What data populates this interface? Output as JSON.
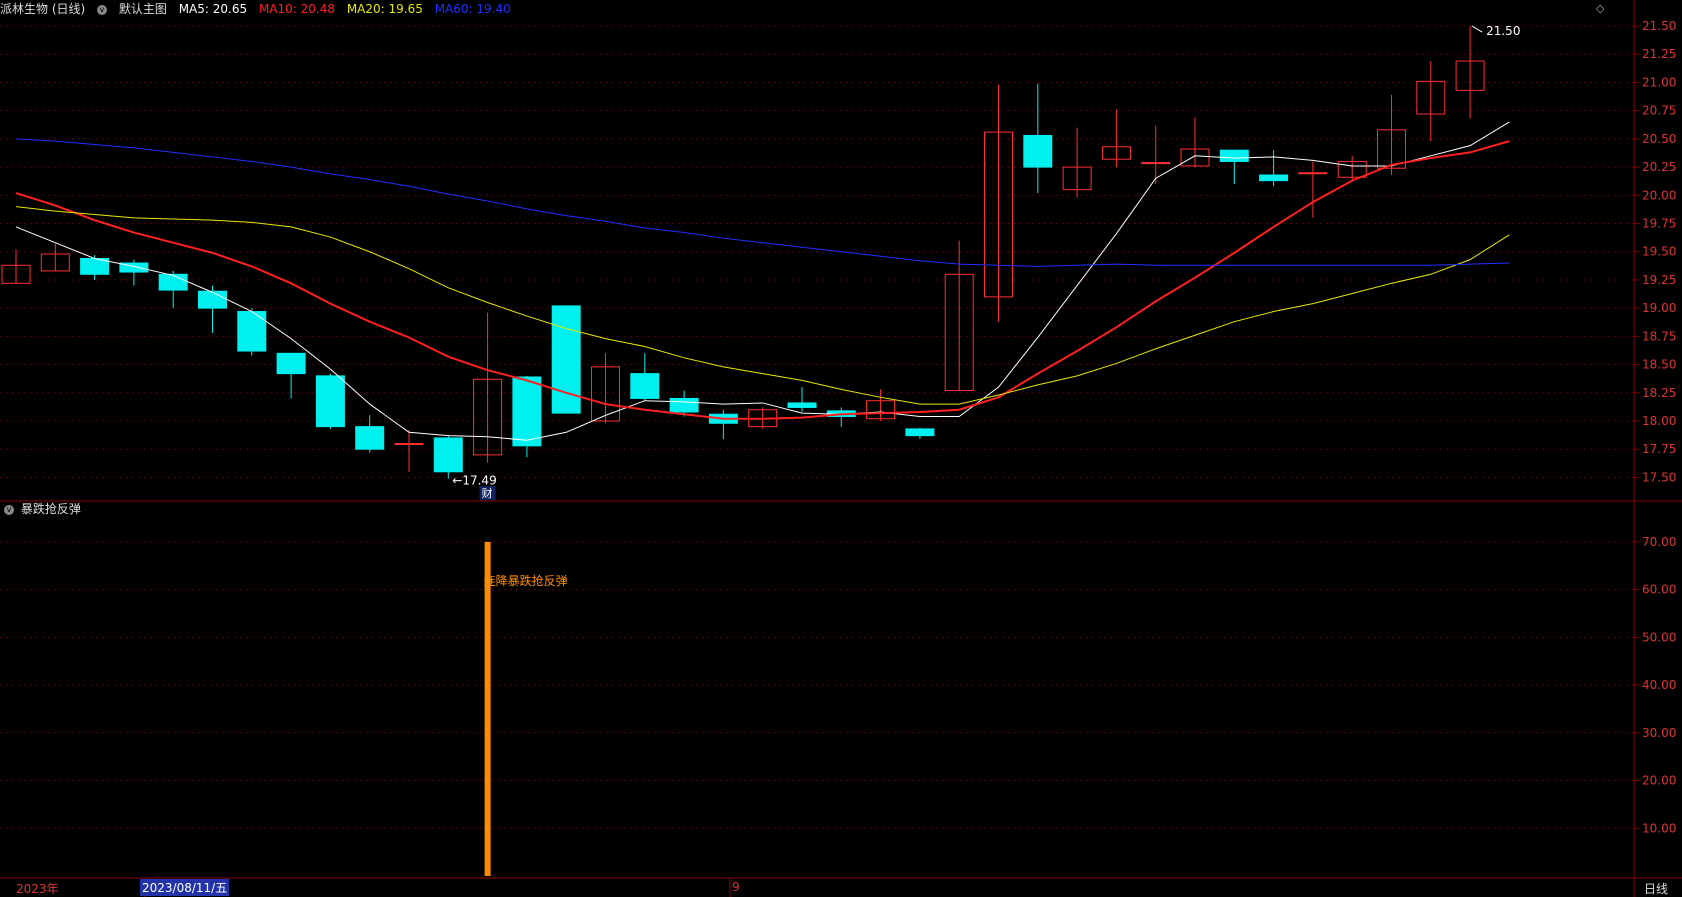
{
  "header": {
    "stock": "派林生物 (日线)",
    "layout": "默认主图",
    "ma5": "MA5: 20.65",
    "ma10": "MA10: 20.48",
    "ma20": "MA20: 19.65",
    "ma60": "MA60: 19.40",
    "colors": {
      "ma5": "#ffffff",
      "ma10": "#ff2020",
      "ma20": "#e8e800",
      "ma60": "#2030ff"
    }
  },
  "indicator_title": "暴跌抢反弹",
  "footer": {
    "year_label": "2023年",
    "cursor_date": "2023/08/11/五",
    "month_label": "9",
    "period_label": "日线"
  },
  "chart_data": [
    {
      "type": "candlestick",
      "title": "派林生物 (日线)",
      "ylim": [
        17.3,
        21.58
      ],
      "yticks": [
        "21.50",
        "21.25",
        "21.00",
        "20.75",
        "20.50",
        "20.25",
        "20.00",
        "19.75",
        "19.50",
        "19.25",
        "19.00",
        "18.75",
        "18.50",
        "18.25",
        "18.00",
        "17.75",
        "17.50"
      ],
      "annotations": [
        {
          "text": "17.49",
          "bar": 11
        },
        {
          "text": "21.50",
          "bar": 37
        },
        {
          "text": "财",
          "bar": 12
        }
      ],
      "bars": [
        {
          "o": 19.22,
          "c": 19.38,
          "h": 19.52,
          "l": 19.22
        },
        {
          "o": 19.33,
          "c": 19.48,
          "h": 19.57,
          "l": 19.33
        },
        {
          "o": 19.44,
          "c": 19.3,
          "h": 19.47,
          "l": 19.25
        },
        {
          "o": 19.4,
          "c": 19.32,
          "h": 19.43,
          "l": 19.2
        },
        {
          "o": 19.3,
          "c": 19.16,
          "h": 19.33,
          "l": 19.0
        },
        {
          "o": 19.15,
          "c": 19.0,
          "h": 19.2,
          "l": 18.78
        },
        {
          "o": 18.97,
          "c": 18.62,
          "h": 19.0,
          "l": 18.58
        },
        {
          "o": 18.6,
          "c": 18.42,
          "h": 18.6,
          "l": 18.2
        },
        {
          "o": 18.4,
          "c": 17.95,
          "h": 18.42,
          "l": 17.93
        },
        {
          "o": 17.95,
          "c": 17.75,
          "h": 18.05,
          "l": 17.72
        },
        {
          "o": 17.8,
          "c": 17.8,
          "h": 17.92,
          "l": 17.55
        },
        {
          "o": 17.85,
          "c": 17.55,
          "h": 17.87,
          "l": 17.49
        },
        {
          "o": 17.7,
          "c": 18.37,
          "h": 18.96,
          "l": 17.63
        },
        {
          "o": 18.39,
          "c": 17.78,
          "h": 18.4,
          "l": 17.68
        },
        {
          "o": 19.02,
          "c": 18.07,
          "h": 19.02,
          "l": 18.07
        },
        {
          "o": 18.0,
          "c": 18.48,
          "h": 18.6,
          "l": 17.98
        },
        {
          "o": 18.42,
          "c": 18.2,
          "h": 18.6,
          "l": 18.18
        },
        {
          "o": 18.2,
          "c": 18.08,
          "h": 18.27,
          "l": 18.04
        },
        {
          "o": 18.06,
          "c": 17.98,
          "h": 18.1,
          "l": 17.84
        },
        {
          "o": 17.95,
          "c": 18.1,
          "h": 18.12,
          "l": 17.93
        },
        {
          "o": 18.16,
          "c": 18.12,
          "h": 18.3,
          "l": 18.08
        },
        {
          "o": 18.09,
          "c": 18.04,
          "h": 18.12,
          "l": 17.95
        },
        {
          "o": 18.02,
          "c": 18.18,
          "h": 18.28,
          "l": 18.0
        },
        {
          "o": 17.93,
          "c": 17.87,
          "h": 17.94,
          "l": 17.84
        },
        {
          "o": 18.27,
          "c": 19.3,
          "h": 19.6,
          "l": 18.27
        },
        {
          "o": 19.1,
          "c": 20.56,
          "h": 20.98,
          "l": 18.88
        },
        {
          "o": 20.53,
          "c": 20.25,
          "h": 20.99,
          "l": 20.02
        },
        {
          "o": 20.05,
          "c": 20.25,
          "h": 20.6,
          "l": 19.98
        },
        {
          "o": 20.32,
          "c": 20.43,
          "h": 20.76,
          "l": 20.25
        },
        {
          "o": 20.29,
          "c": 20.29,
          "h": 20.62,
          "l": 20.1
        },
        {
          "o": 20.26,
          "c": 20.41,
          "h": 20.69,
          "l": 20.25
        },
        {
          "o": 20.4,
          "c": 20.3,
          "h": 20.4,
          "l": 20.1
        },
        {
          "o": 20.18,
          "c": 20.13,
          "h": 20.4,
          "l": 20.08
        },
        {
          "o": 20.2,
          "c": 20.2,
          "h": 20.3,
          "l": 19.8
        },
        {
          "o": 20.16,
          "c": 20.3,
          "h": 20.35,
          "l": 20.12
        },
        {
          "o": 20.24,
          "c": 20.58,
          "h": 20.89,
          "l": 20.18
        },
        {
          "o": 20.72,
          "c": 21.01,
          "h": 21.19,
          "l": 20.48
        },
        {
          "o": 20.93,
          "c": 21.19,
          "h": 21.5,
          "l": 20.68
        }
      ],
      "series": [
        {
          "name": "MA5",
          "values": [
            19.72,
            19.58,
            19.44,
            19.37,
            19.29,
            19.14,
            18.97,
            18.73,
            18.46,
            18.15,
            17.9,
            17.87,
            17.86,
            17.83,
            17.9,
            18.05,
            18.18,
            18.17,
            18.15,
            18.16,
            18.07,
            18.06,
            18.08,
            18.04,
            18.04,
            18.3,
            18.74,
            19.2,
            19.66,
            20.15,
            20.35,
            20.33,
            20.34,
            20.31,
            20.26,
            20.26,
            20.35,
            20.44,
            20.65
          ]
        },
        {
          "name": "MA10",
          "values": [
            20.02,
            19.91,
            19.78,
            19.67,
            19.58,
            19.49,
            19.37,
            19.22,
            19.04,
            18.88,
            18.74,
            18.57,
            18.45,
            18.36,
            18.25,
            18.15,
            18.1,
            18.06,
            18.02,
            18.02,
            18.03,
            18.06,
            18.07,
            18.08,
            18.1,
            18.21,
            18.42,
            18.62,
            18.83,
            19.06,
            19.27,
            19.49,
            19.72,
            19.94,
            20.13,
            20.27,
            20.33,
            20.38,
            20.48
          ]
        },
        {
          "name": "MA20",
          "values": [
            19.9,
            19.86,
            19.83,
            19.8,
            19.79,
            19.78,
            19.76,
            19.72,
            19.63,
            19.5,
            19.35,
            19.18,
            19.05,
            18.93,
            18.82,
            18.73,
            18.66,
            18.56,
            18.48,
            18.42,
            18.36,
            18.28,
            18.21,
            18.15,
            18.15,
            18.23,
            18.32,
            18.4,
            18.51,
            18.64,
            18.76,
            18.88,
            18.97,
            19.04,
            19.13,
            19.22,
            19.3,
            19.43,
            19.65
          ]
        },
        {
          "name": "MA60",
          "values": [
            20.5,
            20.48,
            20.45,
            20.42,
            20.38,
            20.34,
            20.3,
            20.25,
            20.19,
            20.14,
            20.08,
            20.01,
            19.95,
            19.88,
            19.82,
            19.77,
            19.71,
            19.67,
            19.62,
            19.58,
            19.54,
            19.5,
            19.46,
            19.42,
            19.39,
            19.38,
            19.37,
            19.38,
            19.39,
            19.38,
            19.38,
            19.38,
            19.38,
            19.38,
            19.38,
            19.38,
            19.38,
            19.39,
            19.4
          ]
        }
      ]
    },
    {
      "type": "bar",
      "title": "暴跌抢反弹",
      "ylim": [
        0,
        75
      ],
      "yticks": [
        "70.00",
        "60.00",
        "50.00",
        "40.00",
        "30.00",
        "20.00",
        "10.00"
      ],
      "bars": [
        {
          "bar": 12,
          "value": 70,
          "label": "连降暴跌抢反弹"
        }
      ]
    }
  ]
}
